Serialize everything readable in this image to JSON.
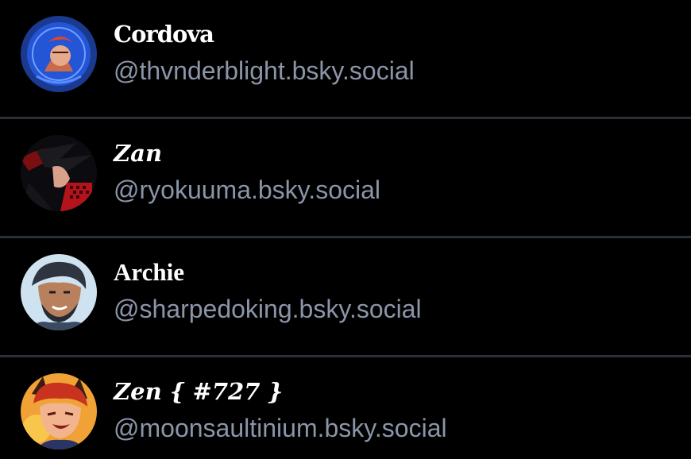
{
  "users": [
    {
      "display_name": "Cordova",
      "handle": "@thvnderblight.bsky.social",
      "avatar_icon": "avatar-icon"
    },
    {
      "display_name": "Zan",
      "handle": "@ryokuuma.bsky.social",
      "avatar_icon": "avatar-icon"
    },
    {
      "display_name": "Archie",
      "handle": "@sharpedoking.bsky.social",
      "avatar_icon": "avatar-icon"
    },
    {
      "display_name": "Zen { #727 }",
      "handle": "@moonsaultinium.bsky.social",
      "avatar_icon": "avatar-icon"
    }
  ],
  "colors": {
    "background": "#000000",
    "divider": "#2b2f3a",
    "name": "#ffffff",
    "handle": "#8b95a8"
  }
}
